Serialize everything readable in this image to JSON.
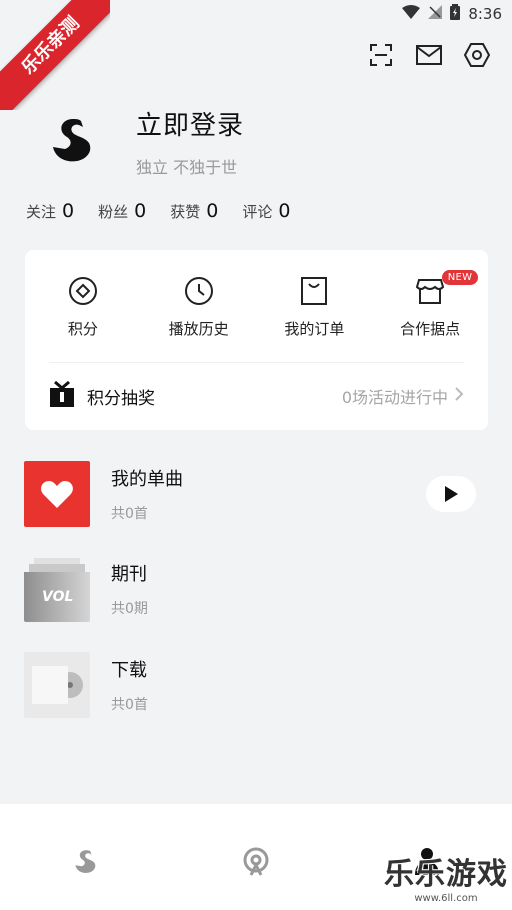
{
  "status_bar": {
    "time": "8:36"
  },
  "corner_banner": {
    "text": "乐乐亲测"
  },
  "profile": {
    "title": "立即登录",
    "subtitle": "独立 不独于世"
  },
  "stats": [
    {
      "label": "关注",
      "value": "0"
    },
    {
      "label": "粉丝",
      "value": "0"
    },
    {
      "label": "获赞",
      "value": "0"
    },
    {
      "label": "评论",
      "value": "0"
    }
  ],
  "grid": [
    {
      "label": "积分",
      "icon": "points-icon"
    },
    {
      "label": "播放历史",
      "icon": "clock-icon"
    },
    {
      "label": "我的订单",
      "icon": "bag-icon"
    },
    {
      "label": "合作据点",
      "icon": "store-icon",
      "badge": "NEW"
    }
  ],
  "lottery": {
    "label": "积分抽奖",
    "status": "0场活动进行中"
  },
  "list": [
    {
      "title": "我的单曲",
      "sub": "共0首"
    },
    {
      "title": "期刊",
      "sub": "共0期",
      "thumb_text": "VOL"
    },
    {
      "title": "下载",
      "sub": "共0首"
    }
  ],
  "watermark": {
    "main": "乐乐游戏",
    "sub": "www.6ll.com"
  },
  "colors": {
    "accent": "#e2353a",
    "background": "#f2f3f5"
  }
}
